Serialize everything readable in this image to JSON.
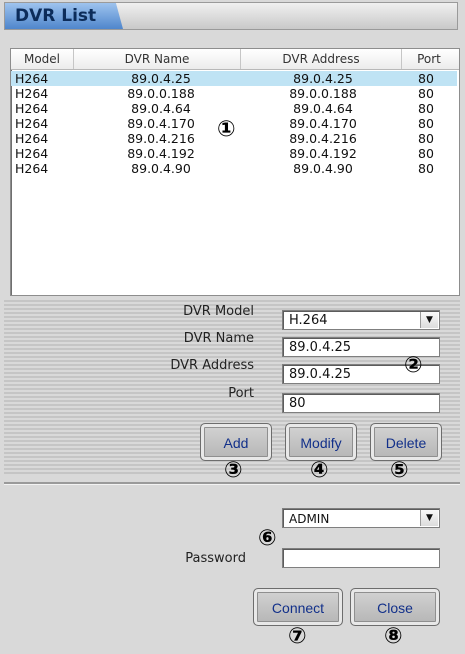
{
  "window": {
    "title": "DVR List"
  },
  "list": {
    "columns": [
      "Model",
      "DVR Name",
      "DVR Address",
      "Port"
    ],
    "rows": [
      {
        "model": "H264",
        "name": "89.0.4.25",
        "address": "89.0.4.25",
        "port": "80"
      },
      {
        "model": "H264",
        "name": "89.0.0.188",
        "address": "89.0.0.188",
        "port": "80"
      },
      {
        "model": "H264",
        "name": "89.0.4.64",
        "address": "89.0.4.64",
        "port": "80"
      },
      {
        "model": "H264",
        "name": "89.0.4.170",
        "address": "89.0.4.170",
        "port": "80"
      },
      {
        "model": "H264",
        "name": "89.0.4.216",
        "address": "89.0.4.216",
        "port": "80"
      },
      {
        "model": "H264",
        "name": "89.0.4.192",
        "address": "89.0.4.192",
        "port": "80"
      },
      {
        "model": "H264",
        "name": "89.0.4.90",
        "address": "89.0.4.90",
        "port": "80"
      }
    ]
  },
  "form": {
    "dvr_model_label": "DVR Model",
    "dvr_model_value": "H.264",
    "dvr_name_label": "DVR Name",
    "dvr_name_value": "89.0.4.25",
    "dvr_address_label": "DVR Address",
    "dvr_address_value": "89.0.4.25",
    "port_label": "Port",
    "port_value": "80",
    "add_label": "Add",
    "modify_label": "Modify",
    "delete_label": "Delete"
  },
  "login": {
    "user_value": "ADMIN",
    "password_label": "Password",
    "password_value": "",
    "connect_label": "Connect",
    "close_label": "Close"
  },
  "callouts": {
    "n1": "①",
    "n2": "②",
    "n3": "③",
    "n4": "④",
    "n5": "⑤",
    "n6": "⑥",
    "n7": "⑦",
    "n8": "⑧"
  }
}
